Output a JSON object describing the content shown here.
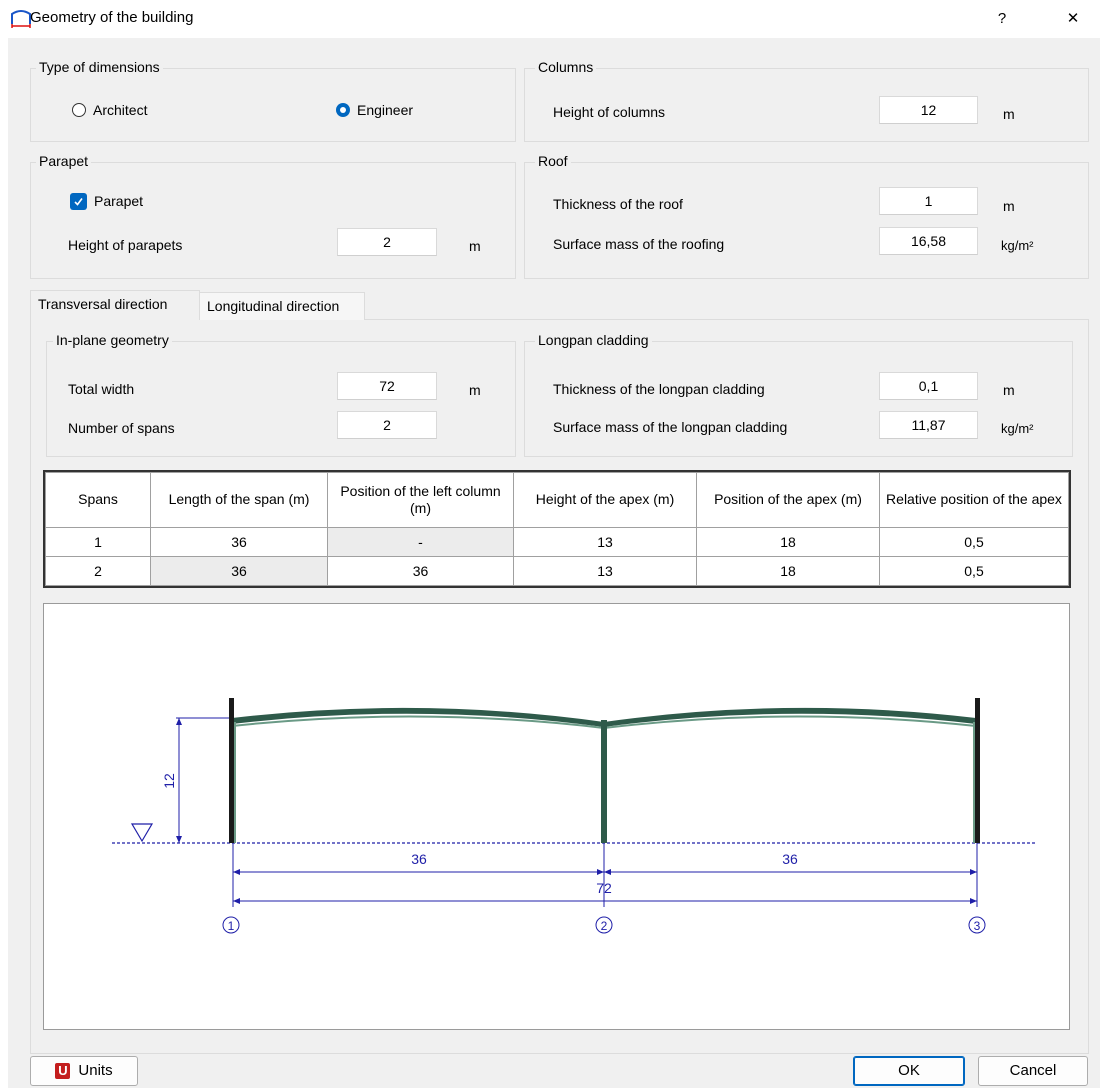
{
  "window": {
    "title": "Geometry of the building",
    "help": "?",
    "close": "✕"
  },
  "type_of_dimensions": {
    "title": "Type of dimensions",
    "option1": "Architect",
    "option2": "Engineer",
    "selected": "Engineer"
  },
  "columns": {
    "title": "Columns",
    "height_label": "Height of columns",
    "height_value": "12",
    "unit": "m"
  },
  "parapet": {
    "title": "Parapet",
    "checkbox_label": "Parapet",
    "checked": true,
    "height_label": "Height of parapets",
    "height_value": "2",
    "unit": "m"
  },
  "roof": {
    "title": "Roof",
    "thickness_label": "Thickness of the roof",
    "thickness_value": "1",
    "thickness_unit": "m",
    "mass_label": "Surface mass of the roofing",
    "mass_value": "16,58",
    "mass_unit": "kg/m²"
  },
  "tabs": [
    {
      "label": "Transversal direction",
      "active": true
    },
    {
      "label": "Longitudinal direction",
      "active": false
    }
  ],
  "in_plane": {
    "title": "In-plane geometry",
    "width_label": "Total width",
    "width_value": "72",
    "width_unit": "m",
    "spans_label": "Number of spans",
    "spans_value": "2"
  },
  "longpan": {
    "title": "Longpan cladding",
    "thickness_label": "Thickness of the longpan cladding",
    "thickness_value": "0,1",
    "thickness_unit": "m",
    "mass_label": "Surface mass of the longpan cladding",
    "mass_value": "11,87",
    "mass_unit": "kg/m²"
  },
  "table": {
    "headers": [
      "Spans",
      "Length of the span (m)",
      "Position of the left column (m)",
      "Height of the apex (m)",
      "Position of the apex (m)",
      "Relative position of the apex"
    ],
    "rows": [
      [
        "1",
        "36",
        "-",
        "13",
        "18",
        "0,5"
      ],
      [
        "2",
        "36",
        "36",
        "13",
        "18",
        "0,5"
      ]
    ]
  },
  "drawing": {
    "height_dim": "12",
    "span_dims": [
      "36",
      "36"
    ],
    "total_dim": "72",
    "axis_labels": [
      "1",
      "2",
      "3"
    ],
    "colors": {
      "dimension": "#1f1fa8",
      "frame": "#2e5a4a",
      "frame_dark": "#1a1a1a"
    }
  },
  "buttons": {
    "units": "Units",
    "ok": "OK",
    "cancel": "Cancel"
  },
  "colors": {
    "accent": "#0067c0",
    "units_icon": "#c41e1e",
    "title_icon": "#1a56c8"
  }
}
